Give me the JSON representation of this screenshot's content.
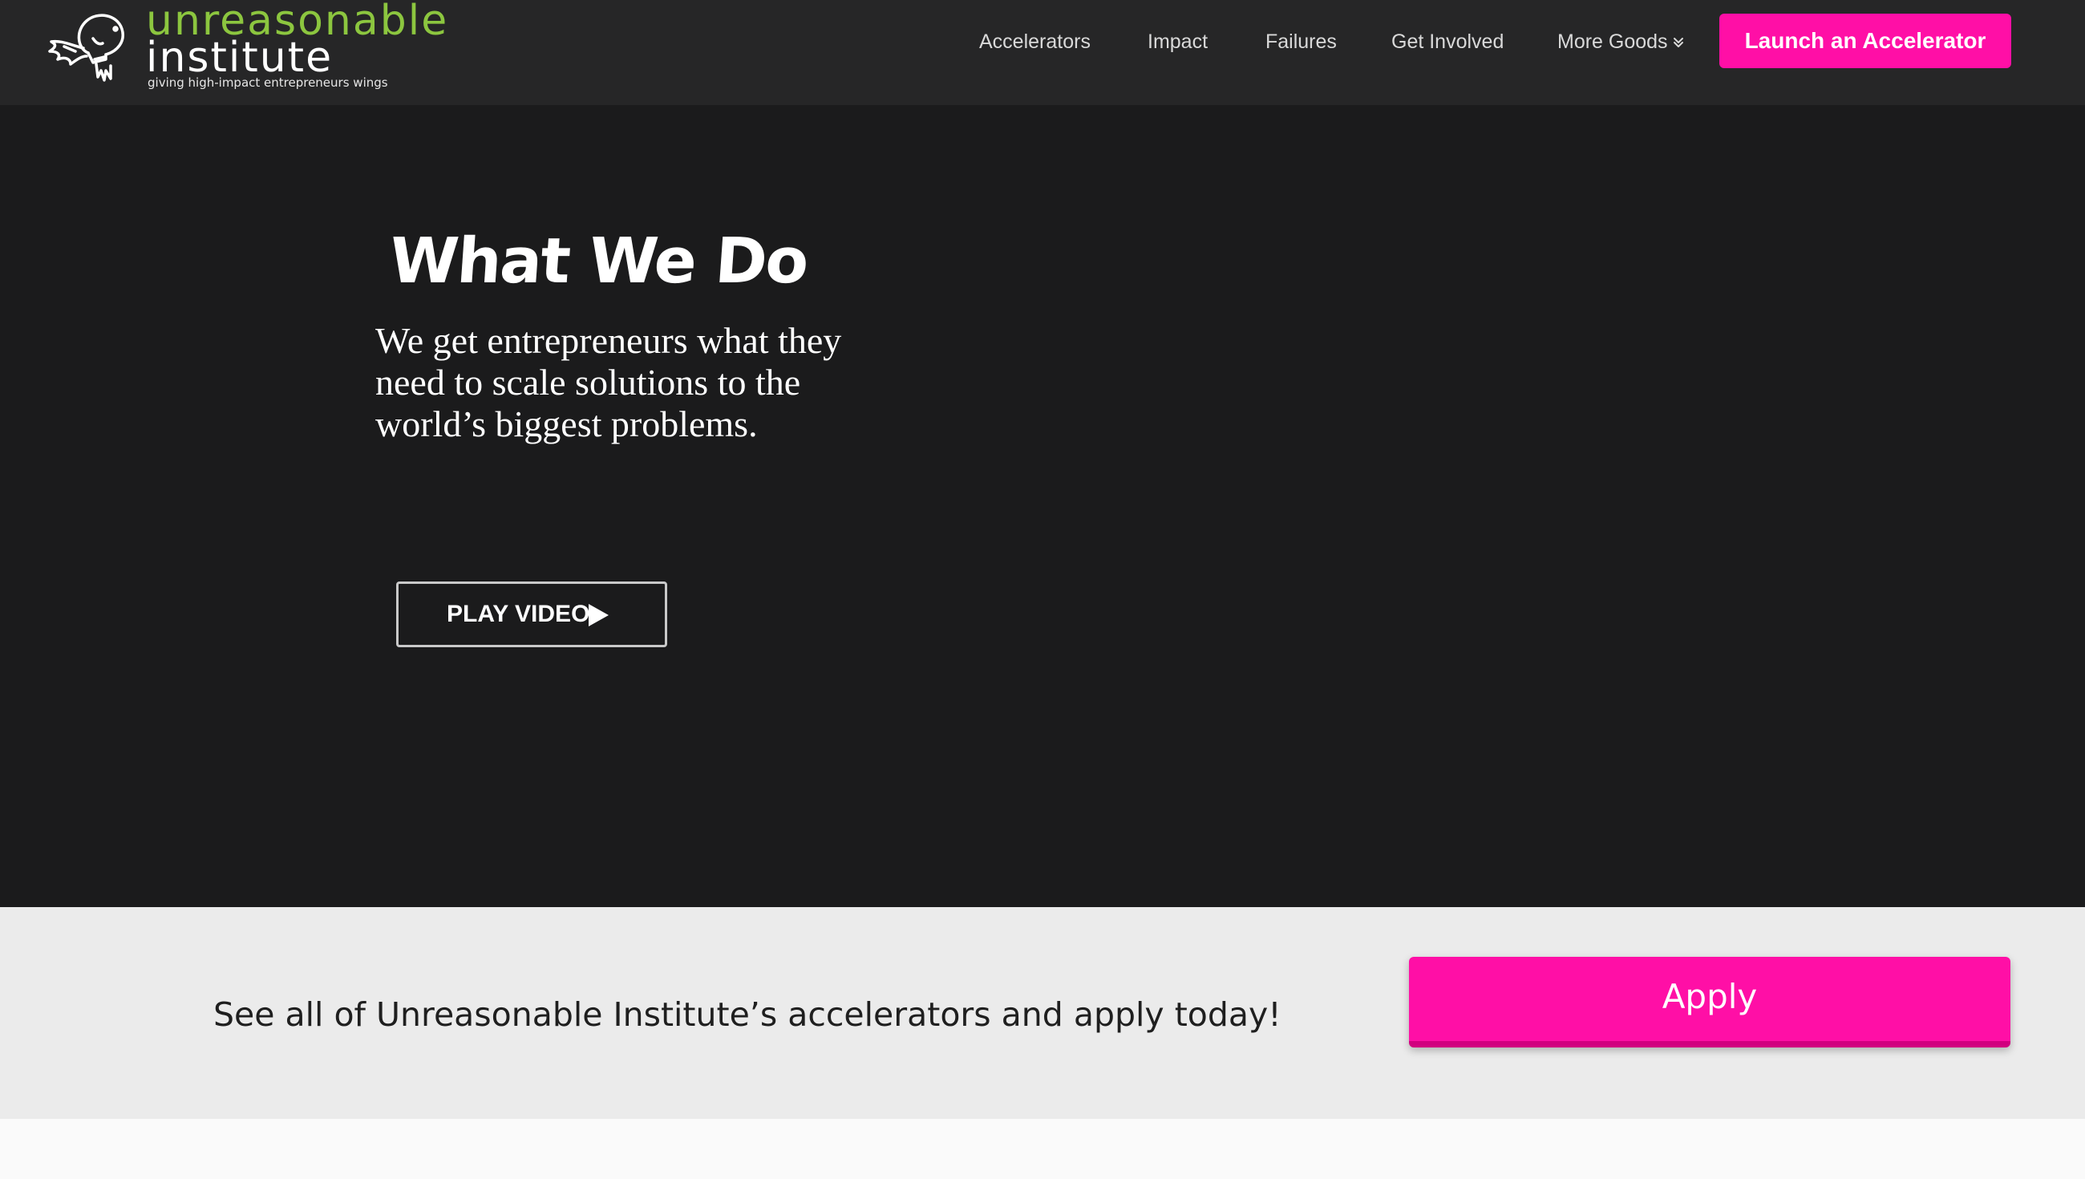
{
  "brand": {
    "name_line1": "unreasonable",
    "name_line2": "institute",
    "tagline": "giving high-impact entrepreneurs wings",
    "accent_green": "#8cc63f",
    "logo_icon": "winged-lightbulb-icon"
  },
  "nav": {
    "items": [
      {
        "label": "Accelerators"
      },
      {
        "label": "Impact"
      },
      {
        "label": "Failures"
      },
      {
        "label": "Get Involved"
      },
      {
        "label": "More Goods",
        "has_dropdown": true,
        "icon": "chevron-double-down-icon"
      }
    ],
    "cta_label": "Launch an Accelerator",
    "cta_color": "#ff0fa6"
  },
  "hero": {
    "title": "What We Do",
    "text": "We get entrepreneurs what they need to scale solutions to the world’s biggest problems.",
    "play_label": "PLAY VIDEO",
    "play_icon": "play-triangle-icon",
    "background": "#1b1b1c"
  },
  "apply_band": {
    "text": "See all of Unreasonable Institute’s accelerators and apply today!",
    "button_label": "Apply",
    "button_color": "#ff0fa6"
  }
}
